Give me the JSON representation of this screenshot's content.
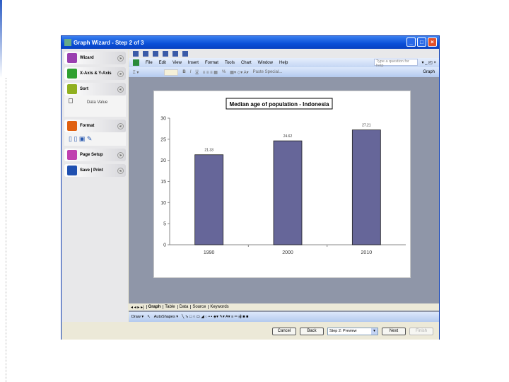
{
  "window": {
    "title": "Graph Wizard - Step 2 of 3"
  },
  "sidebar": {
    "sections": [
      {
        "label": "Wizard",
        "color": "#9a3fb0"
      },
      {
        "label": "X-Axis & Y-Axis",
        "color": "#30a030"
      },
      {
        "label": "Sort",
        "color": "#90b020",
        "sub": "Data Value"
      },
      {
        "label": "Format",
        "color": "#e06010"
      },
      {
        "label": "Page Setup",
        "color": "#c040b0"
      },
      {
        "label": "Save | Print",
        "color": "#2050b0"
      }
    ]
  },
  "menu": [
    "File",
    "Edit",
    "View",
    "Insert",
    "Format",
    "Tools",
    "Chart",
    "Window",
    "Help"
  ],
  "ask_placeholder": "Type a question for help",
  "toolbar": {
    "sigma": "Σ ▾",
    "paste_special": "Paste Special...",
    "graph": "Graph"
  },
  "sheet_tabs": [
    "Graph",
    "Table",
    "Data",
    "Source",
    "Keywords"
  ],
  "draw": {
    "draw": "Draw ▾",
    "autoshapes": "AutoShapes ▾"
  },
  "buttons": {
    "cancel": "Cancel",
    "back": "Back",
    "step": "Step 2: Preview",
    "next": "Next",
    "finish": "Finish"
  },
  "chart_data": {
    "type": "bar",
    "title": "Median age of population - Indonesia",
    "categories": [
      "1990",
      "2000",
      "2010"
    ],
    "values": [
      21.33,
      24.62,
      27.21
    ],
    "value_labels": [
      "21.33",
      "24.62",
      "27.21"
    ],
    "ylim": [
      0,
      30
    ],
    "yticks": [
      "0",
      "5",
      "10",
      "15",
      "20",
      "25",
      "30"
    ],
    "bar_color": "#666699",
    "xlabel": "",
    "ylabel": ""
  }
}
